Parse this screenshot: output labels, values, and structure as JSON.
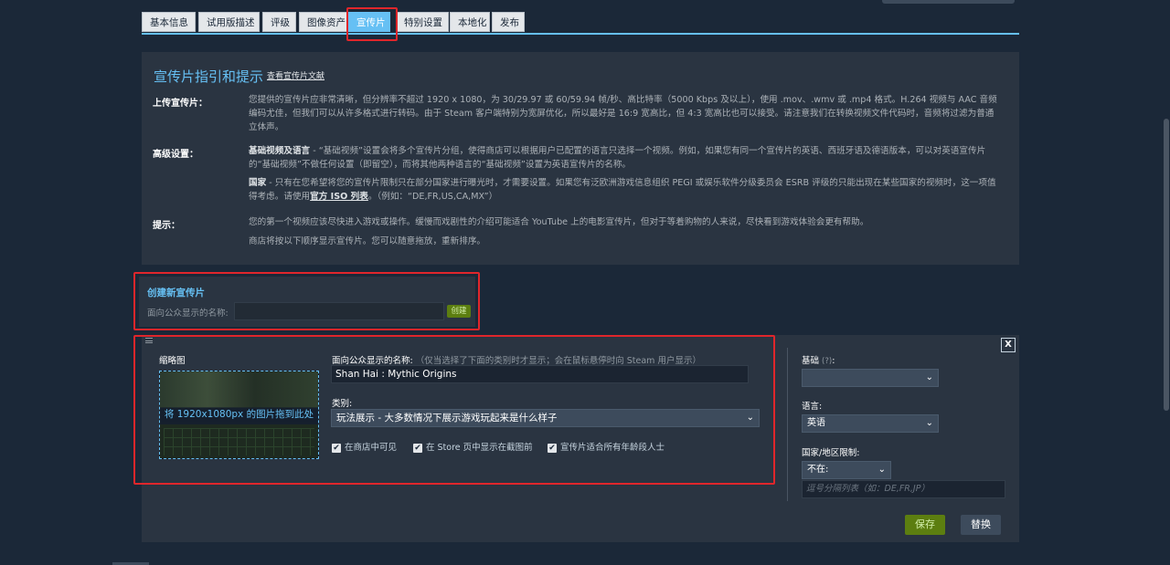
{
  "tabs": [
    {
      "label": "基本信息"
    },
    {
      "label": "试用版描述"
    },
    {
      "label": "评级"
    },
    {
      "label": "图像资产"
    },
    {
      "label": "宣传片"
    },
    {
      "label": "特别设置"
    },
    {
      "label": "本地化"
    },
    {
      "label": "发布"
    }
  ],
  "active_tab": "宣传片",
  "guide": {
    "title": "宣传片指引和提示",
    "doc_link": "查看宣传片文献",
    "upload_label": "上传宣传片：",
    "upload_text": "您提供的宣传片应非常清晰，但分辨率不超过 1920 x 1080，为 30/29.97 或 60/59.94 帧/秒、高比特率（5000 Kbps 及以上），使用 .mov、.wmv 或 .mp4 格式。H.264 视频与 AAC 音频编码尤佳，但我们可以从许多格式进行转码。由于 Steam 客户端特别为宽屏优化，所以最好是 16:9 宽高比，但 4:3 宽高比也可以接受。请注意我们在转换视频文件代码时，音频将过滤为普通立体声。",
    "advanced_label": "高级设置：",
    "advanced_p1_bold": "基础视频及语言",
    "advanced_p1_text": " - “基础视频”设置会将多个宣传片分组，使得商店可以根据用户已配置的语言只选择一个视频。例如，如果您有同一个宣传片的英语、西班牙语及德语版本，可以对英语宣传片的“基础视频”不做任何设置（即留空），而将其他两种语言的“基础视频”设置为英语宣传片的名称。",
    "advanced_p2_bold": "国家",
    "advanced_p2_text": " - 只有在您希望将您的宣传片限制只在部分国家进行曝光时，才需要设置。如果您有泛欧洲游戏信息组织 PEGI 或娱乐软件分级委员会 ESRB 评级的只能出现在某些国家的视频时，这一项值得考虑。请使用",
    "advanced_p2_link": "官方 ISO 列表",
    "advanced_p2_tail": "。（例如：“DE,FR,US,CA,MX”）",
    "tips_label": "提示：",
    "tips_text1": "您的第一个视频应该尽快进入游戏或操作。缓慢而戏剧性的介绍可能适合 YouTube 上的电影宣传片，但对于等着购物的人来说，尽快看到游戏体验会更有帮助。",
    "tips_text2": "商店将按以下顺序显示宣传片。您可以随意拖放，重新排序。"
  },
  "create": {
    "title": "创建新宣传片",
    "name_label": "面向公众显示的名称:",
    "name_value": "",
    "button": "创建"
  },
  "editor": {
    "close": "X",
    "thumb_label": "缩略图",
    "thumb_drop_text": "将 1920x1080px 的图片拖到此处",
    "name_label": "面向公众显示的名称:",
    "name_hint": "（仅当选择了下面的类别时才显示；会在鼠标悬停时向 Steam 用户显示）",
    "name_value": "Shan Hai : Mythic Origins",
    "category_label": "类别:",
    "category_value": "玩法展示 - 大多数情况下展示游戏玩起来是什么样子",
    "checkboxes": [
      {
        "label": "在商店中可见",
        "checked": true
      },
      {
        "label": "在 Store 页中显示在截图前",
        "checked": true
      },
      {
        "label": "宣传片适合所有年龄段人士",
        "checked": true
      }
    ],
    "base_label": "基础",
    "base_help": "(?)",
    "base_colon": ":",
    "base_value": "",
    "lang_label": "语言:",
    "lang_value": "英语",
    "region_label": "国家/地区限制:",
    "region_value": "不在:",
    "region_placeholder": "逗号分隔列表（如：DE,FR,JP）",
    "save": "保存",
    "replace": "替换"
  }
}
